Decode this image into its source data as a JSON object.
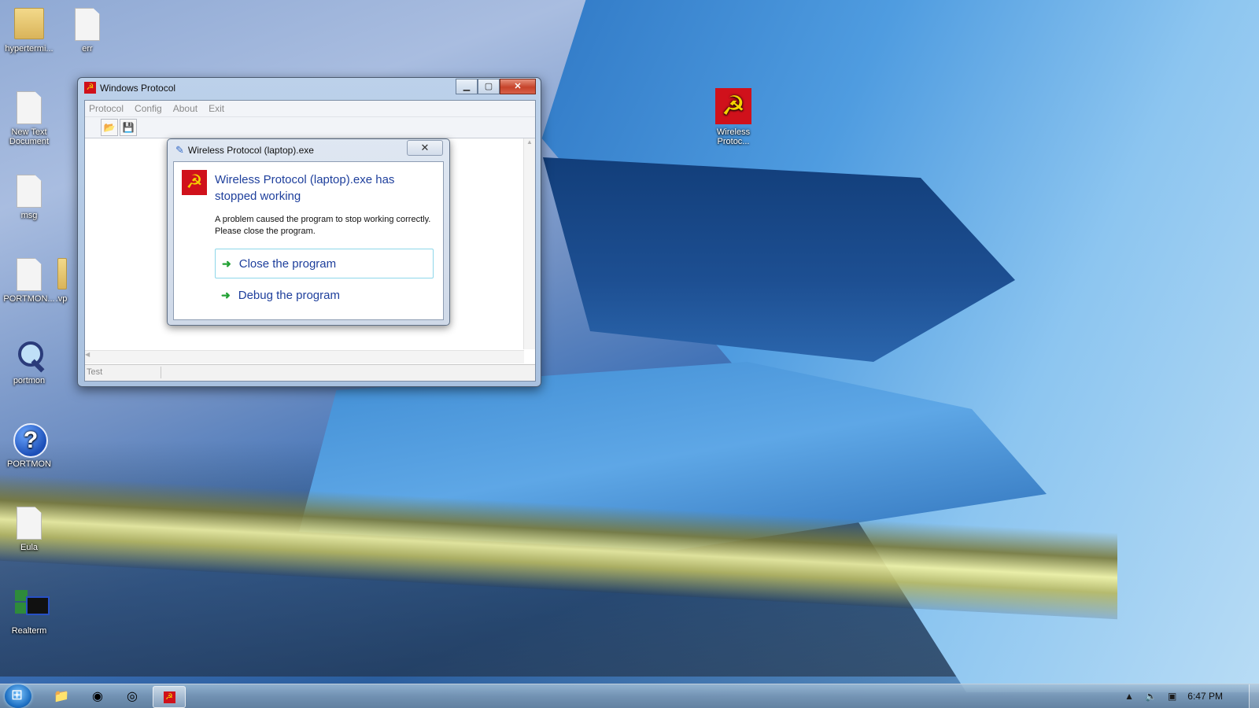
{
  "desktop_icons": [
    {
      "label": "hypertermi...",
      "icon": "folder-icon"
    },
    {
      "label": "err",
      "icon": "text-file-icon"
    },
    {
      "label": "New Text Document",
      "icon": "text-file-icon"
    },
    {
      "label": "msg",
      "icon": "text-file-icon"
    },
    {
      "label": "PORTMON...",
      "icon": "file-icon"
    },
    {
      "label": "portmon",
      "icon": "magnifier-icon"
    },
    {
      "label": "PORTMON",
      "icon": "help-icon"
    },
    {
      "label": "Eula",
      "icon": "text-file-icon"
    },
    {
      "label": "Realterm",
      "icon": "realterm-icon"
    },
    {
      "label": "Wireless Protoc...",
      "icon": "hammer-sickle-icon"
    },
    {
      "label": ".vp",
      "icon": "folder-icon"
    }
  ],
  "main_window": {
    "title": "Windows Protocol",
    "menu": [
      "Protocol",
      "Config",
      "About",
      "Exit"
    ],
    "status": "Test",
    "controls": {
      "minimize": "▁",
      "maximize": "▢",
      "close": "✕"
    }
  },
  "error_dialog": {
    "title": "Wireless Protocol (laptop).exe",
    "heading": "Wireless Protocol (laptop).exe has stopped working",
    "message": "A problem caused the program to stop working correctly. Please close the program.",
    "options": [
      "Close the program",
      "Debug the program"
    ]
  },
  "taskbar": {
    "items": [
      "explorer-icon",
      "chrome-icon",
      "firefox-icon",
      "wireless-protocol-icon"
    ],
    "clock": "6:47 PM"
  },
  "colors": {
    "accent": "#1e3f9c",
    "icon_red": "#d0111b",
    "icon_yellow": "#f5d300",
    "arrow_green": "#24a236"
  }
}
